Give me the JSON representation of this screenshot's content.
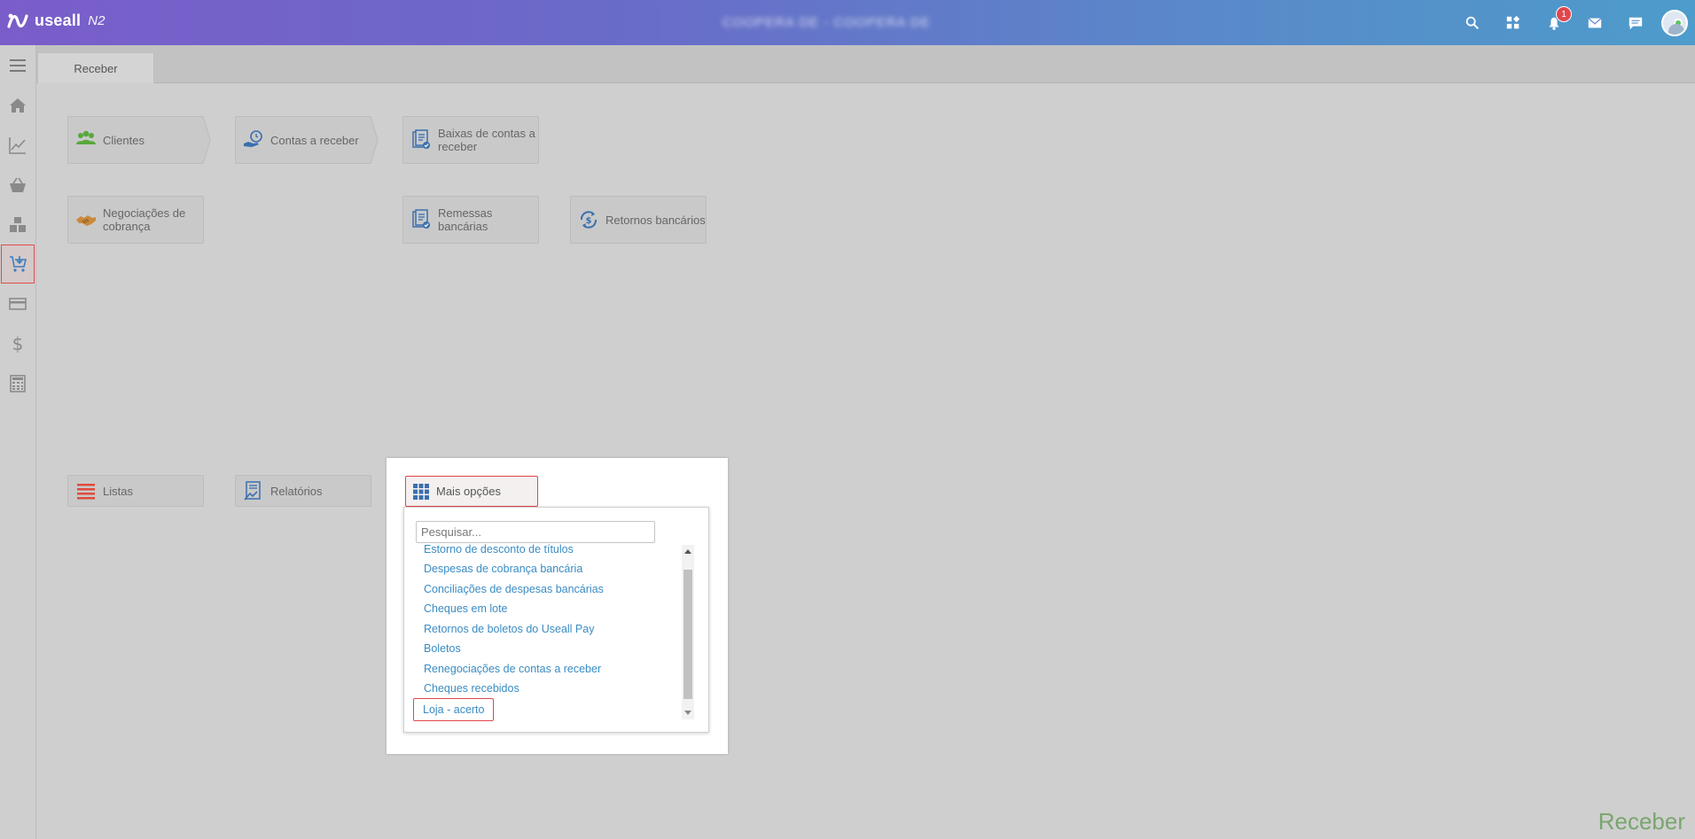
{
  "app": {
    "logo_text": "useall",
    "version": "N2",
    "company_text": "COOPERA DE - COOPERA DE"
  },
  "header": {
    "icons": [
      "search-icon",
      "apps-icon",
      "bell-icon",
      "mail-icon",
      "chat-icon"
    ],
    "notification_count": "1"
  },
  "sidebar": {
    "items": [
      "menu-icon",
      "home-icon",
      "chart-icon",
      "basket-icon",
      "boxes-icon",
      "cart-receive-icon",
      "card-icon",
      "dollar-icon",
      "calculator-icon"
    ],
    "active": "cart-receive-icon"
  },
  "tabs": [
    {
      "label": "Receber"
    }
  ],
  "tiles": {
    "clientes": "Clientes",
    "contas_receber": "Contas a receber",
    "baixas": "Baixas de contas a receber",
    "negociacoes": "Negociações de cobrança",
    "remessas": "Remessas bancárias",
    "retornos": "Retornos bancários",
    "listas": "Listas",
    "relatorios": "Relatórios"
  },
  "popup": {
    "more_button": "Mais opções",
    "search_placeholder": "Pesquisar...",
    "options": [
      "Estorno de desconto de títulos",
      "Despesas de cobrança bancária",
      "Conciliações de despesas bancárias",
      "Cheques em lote",
      "Retornos de boletos do Useall Pay",
      "Boletos",
      "Renegociações de contas a receber",
      "Cheques recebidos",
      "Loja - acerto"
    ],
    "selected_option": "Loja - acerto"
  },
  "footer": {
    "module_name": "Receber"
  },
  "colors": {
    "accent": "#e0474c",
    "link": "#3a8cc4",
    "module_green": "#7aa56f"
  }
}
